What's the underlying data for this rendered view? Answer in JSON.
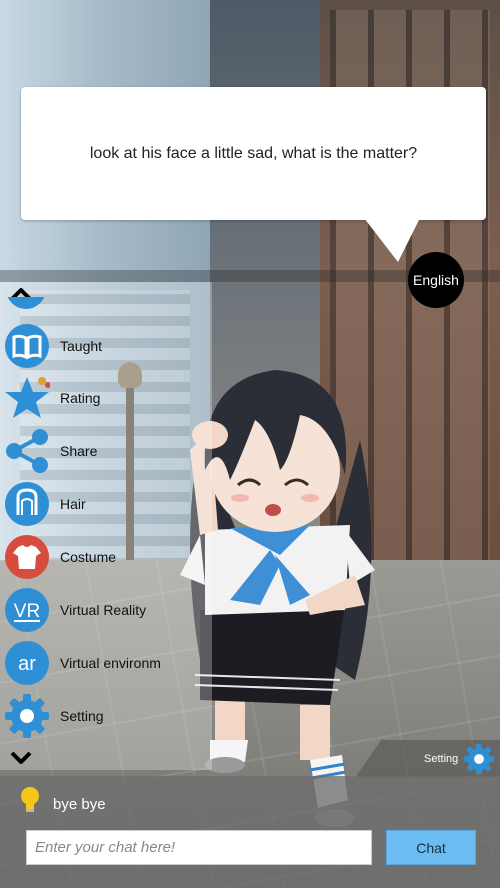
{
  "speech": {
    "text": "look at his face a little sad, what is the matter?"
  },
  "language": {
    "label": "English"
  },
  "menu": {
    "items": [
      {
        "id": "taught",
        "label": "Taught",
        "icon": "book-icon",
        "color": "#2f8fd4"
      },
      {
        "id": "rating",
        "label": "Rating",
        "icon": "star-icon",
        "color": "#2f8fd4"
      },
      {
        "id": "share",
        "label": "Share",
        "icon": "share-icon",
        "color": "#2f8fd4"
      },
      {
        "id": "hair",
        "label": "Hair",
        "icon": "hair-icon",
        "color": "#2f8fd4"
      },
      {
        "id": "costume",
        "label": "Costume",
        "icon": "shirt-icon",
        "color": "#d74c3c"
      },
      {
        "id": "vr",
        "label": "Virtual Reality",
        "icon": "vr-icon",
        "color": "#2f8fd4"
      },
      {
        "id": "ar",
        "label": "Virtual environm",
        "icon": "ar-icon",
        "color": "#2f8fd4"
      },
      {
        "id": "setting",
        "label": "Setting",
        "icon": "gear-icon",
        "color": "#2f8fd4"
      }
    ],
    "vr_text": "VR",
    "ar_text": "ar"
  },
  "setting_corner": {
    "label": "Setting"
  },
  "chat": {
    "reply": "bye bye",
    "placeholder": "Enter your chat here!",
    "button": "Chat"
  }
}
